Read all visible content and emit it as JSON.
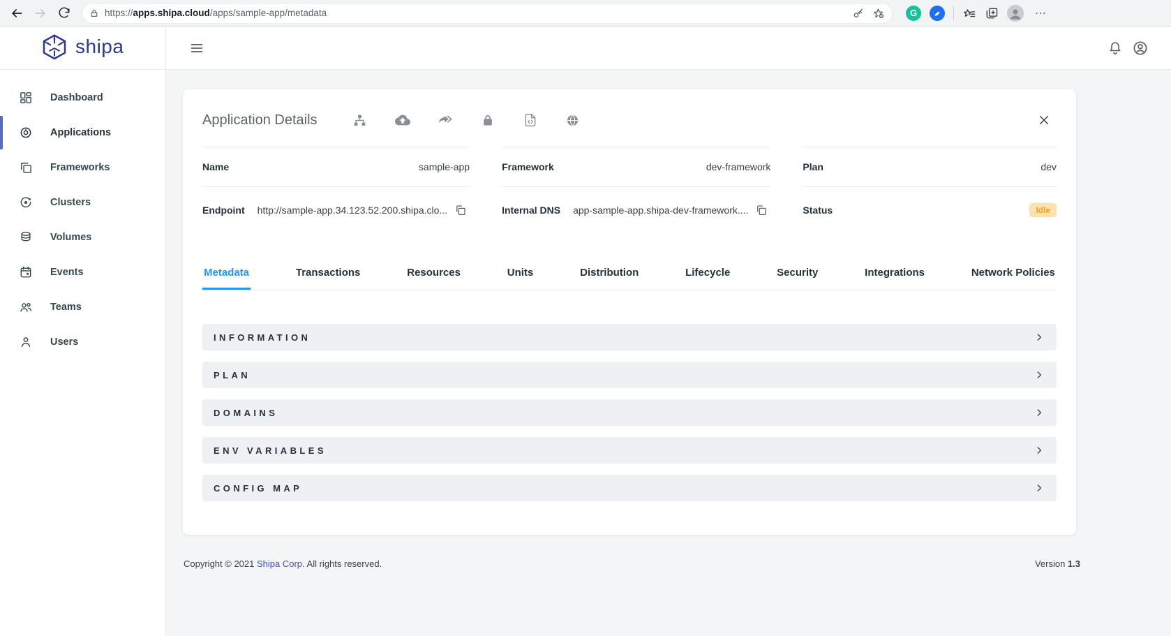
{
  "browser": {
    "url_scheme": "https://",
    "url_host": "apps.shipa.cloud",
    "url_path": "/apps/sample-app/metadata",
    "extension_g": "G",
    "more_glyph": "⋯"
  },
  "sidebar": {
    "logo_text": "shipa",
    "items": [
      {
        "label": "Dashboard",
        "icon": "dashboard-grid-icon",
        "active": false
      },
      {
        "label": "Applications",
        "icon": "applications-icon",
        "active": true
      },
      {
        "label": "Frameworks",
        "icon": "frameworks-icon",
        "active": false
      },
      {
        "label": "Clusters",
        "icon": "clusters-orbit-icon",
        "active": false
      },
      {
        "label": "Volumes",
        "icon": "volumes-database-icon",
        "active": false
      },
      {
        "label": "Events",
        "icon": "events-calendar-icon",
        "active": false
      },
      {
        "label": "Teams",
        "icon": "teams-people-icon",
        "active": false
      },
      {
        "label": "Users",
        "icon": "users-person-icon",
        "active": false
      }
    ]
  },
  "card": {
    "title": "Application Details",
    "action_icons": [
      "topology-icon",
      "cloud-upload-icon",
      "redirect-icon",
      "lock-icon",
      "file-code-icon",
      "globe-icon"
    ],
    "fields": {
      "name": {
        "label": "Name",
        "value": "sample-app"
      },
      "framework": {
        "label": "Framework",
        "value": "dev-framework"
      },
      "plan": {
        "label": "Plan",
        "value": "dev"
      },
      "endpoint": {
        "label": "Endpoint",
        "value": "http://sample-app.34.123.52.200.shipa.clo..."
      },
      "internal_dns": {
        "label": "Internal DNS",
        "value": "app-sample-app.shipa-dev-framework...."
      },
      "status": {
        "label": "Status",
        "value": "Idle"
      }
    },
    "tabs": [
      {
        "label": "Metadata",
        "active": true
      },
      {
        "label": "Transactions",
        "active": false
      },
      {
        "label": "Resources",
        "active": false
      },
      {
        "label": "Units",
        "active": false
      },
      {
        "label": "Distribution",
        "active": false
      },
      {
        "label": "Lifecycle",
        "active": false
      },
      {
        "label": "Security",
        "active": false
      },
      {
        "label": "Integrations",
        "active": false
      },
      {
        "label": "Network Policies",
        "active": false
      }
    ],
    "sections": [
      {
        "label": "INFORMATION"
      },
      {
        "label": "PLAN"
      },
      {
        "label": "DOMAINS"
      },
      {
        "label": "ENV VARIABLES"
      },
      {
        "label": "CONFIG MAP"
      }
    ]
  },
  "footer": {
    "copyright_prefix": "Copyright © 2021 ",
    "copyright_link": "Shipa Corp",
    "copyright_suffix": ". All rights reserved.",
    "version_label": "Version ",
    "version_value": "1.3"
  },
  "colors": {
    "accent_blue": "#2196f3",
    "brand_indigo": "#2d3a8c",
    "active_item_bar": "#5c6bc0",
    "status_idle_bg": "#fce3ad",
    "status_idle_text": "#efa12c",
    "footer_link": "#3f51b5",
    "grammarly_green": "#15c39a"
  }
}
